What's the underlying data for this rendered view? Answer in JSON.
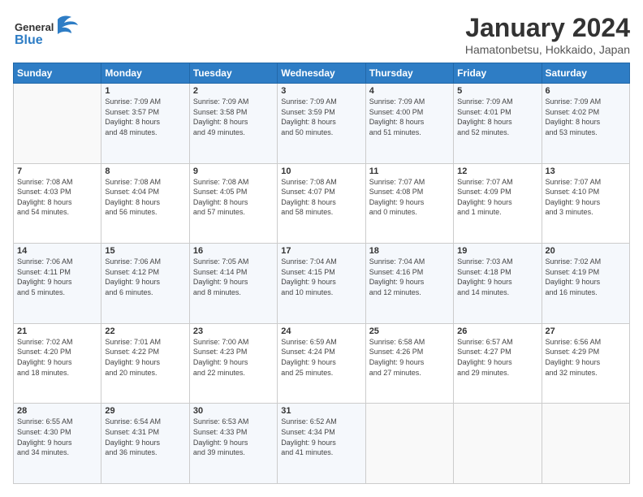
{
  "logo": {
    "general": "General",
    "blue": "Blue"
  },
  "header": {
    "month_year": "January 2024",
    "location": "Hamatonbetsu, Hokkaido, Japan"
  },
  "days_of_week": [
    "Sunday",
    "Monday",
    "Tuesday",
    "Wednesday",
    "Thursday",
    "Friday",
    "Saturday"
  ],
  "weeks": [
    [
      {
        "day": "",
        "info": ""
      },
      {
        "day": "1",
        "info": "Sunrise: 7:09 AM\nSunset: 3:57 PM\nDaylight: 8 hours\nand 48 minutes."
      },
      {
        "day": "2",
        "info": "Sunrise: 7:09 AM\nSunset: 3:58 PM\nDaylight: 8 hours\nand 49 minutes."
      },
      {
        "day": "3",
        "info": "Sunrise: 7:09 AM\nSunset: 3:59 PM\nDaylight: 8 hours\nand 50 minutes."
      },
      {
        "day": "4",
        "info": "Sunrise: 7:09 AM\nSunset: 4:00 PM\nDaylight: 8 hours\nand 51 minutes."
      },
      {
        "day": "5",
        "info": "Sunrise: 7:09 AM\nSunset: 4:01 PM\nDaylight: 8 hours\nand 52 minutes."
      },
      {
        "day": "6",
        "info": "Sunrise: 7:09 AM\nSunset: 4:02 PM\nDaylight: 8 hours\nand 53 minutes."
      }
    ],
    [
      {
        "day": "7",
        "info": "Sunrise: 7:08 AM\nSunset: 4:03 PM\nDaylight: 8 hours\nand 54 minutes."
      },
      {
        "day": "8",
        "info": "Sunrise: 7:08 AM\nSunset: 4:04 PM\nDaylight: 8 hours\nand 56 minutes."
      },
      {
        "day": "9",
        "info": "Sunrise: 7:08 AM\nSunset: 4:05 PM\nDaylight: 8 hours\nand 57 minutes."
      },
      {
        "day": "10",
        "info": "Sunrise: 7:08 AM\nSunset: 4:07 PM\nDaylight: 8 hours\nand 58 minutes."
      },
      {
        "day": "11",
        "info": "Sunrise: 7:07 AM\nSunset: 4:08 PM\nDaylight: 9 hours\nand 0 minutes."
      },
      {
        "day": "12",
        "info": "Sunrise: 7:07 AM\nSunset: 4:09 PM\nDaylight: 9 hours\nand 1 minute."
      },
      {
        "day": "13",
        "info": "Sunrise: 7:07 AM\nSunset: 4:10 PM\nDaylight: 9 hours\nand 3 minutes."
      }
    ],
    [
      {
        "day": "14",
        "info": "Sunrise: 7:06 AM\nSunset: 4:11 PM\nDaylight: 9 hours\nand 5 minutes."
      },
      {
        "day": "15",
        "info": "Sunrise: 7:06 AM\nSunset: 4:12 PM\nDaylight: 9 hours\nand 6 minutes."
      },
      {
        "day": "16",
        "info": "Sunrise: 7:05 AM\nSunset: 4:14 PM\nDaylight: 9 hours\nand 8 minutes."
      },
      {
        "day": "17",
        "info": "Sunrise: 7:04 AM\nSunset: 4:15 PM\nDaylight: 9 hours\nand 10 minutes."
      },
      {
        "day": "18",
        "info": "Sunrise: 7:04 AM\nSunset: 4:16 PM\nDaylight: 9 hours\nand 12 minutes."
      },
      {
        "day": "19",
        "info": "Sunrise: 7:03 AM\nSunset: 4:18 PM\nDaylight: 9 hours\nand 14 minutes."
      },
      {
        "day": "20",
        "info": "Sunrise: 7:02 AM\nSunset: 4:19 PM\nDaylight: 9 hours\nand 16 minutes."
      }
    ],
    [
      {
        "day": "21",
        "info": "Sunrise: 7:02 AM\nSunset: 4:20 PM\nDaylight: 9 hours\nand 18 minutes."
      },
      {
        "day": "22",
        "info": "Sunrise: 7:01 AM\nSunset: 4:22 PM\nDaylight: 9 hours\nand 20 minutes."
      },
      {
        "day": "23",
        "info": "Sunrise: 7:00 AM\nSunset: 4:23 PM\nDaylight: 9 hours\nand 22 minutes."
      },
      {
        "day": "24",
        "info": "Sunrise: 6:59 AM\nSunset: 4:24 PM\nDaylight: 9 hours\nand 25 minutes."
      },
      {
        "day": "25",
        "info": "Sunrise: 6:58 AM\nSunset: 4:26 PM\nDaylight: 9 hours\nand 27 minutes."
      },
      {
        "day": "26",
        "info": "Sunrise: 6:57 AM\nSunset: 4:27 PM\nDaylight: 9 hours\nand 29 minutes."
      },
      {
        "day": "27",
        "info": "Sunrise: 6:56 AM\nSunset: 4:29 PM\nDaylight: 9 hours\nand 32 minutes."
      }
    ],
    [
      {
        "day": "28",
        "info": "Sunrise: 6:55 AM\nSunset: 4:30 PM\nDaylight: 9 hours\nand 34 minutes."
      },
      {
        "day": "29",
        "info": "Sunrise: 6:54 AM\nSunset: 4:31 PM\nDaylight: 9 hours\nand 36 minutes."
      },
      {
        "day": "30",
        "info": "Sunrise: 6:53 AM\nSunset: 4:33 PM\nDaylight: 9 hours\nand 39 minutes."
      },
      {
        "day": "31",
        "info": "Sunrise: 6:52 AM\nSunset: 4:34 PM\nDaylight: 9 hours\nand 41 minutes."
      },
      {
        "day": "",
        "info": ""
      },
      {
        "day": "",
        "info": ""
      },
      {
        "day": "",
        "info": ""
      }
    ]
  ]
}
